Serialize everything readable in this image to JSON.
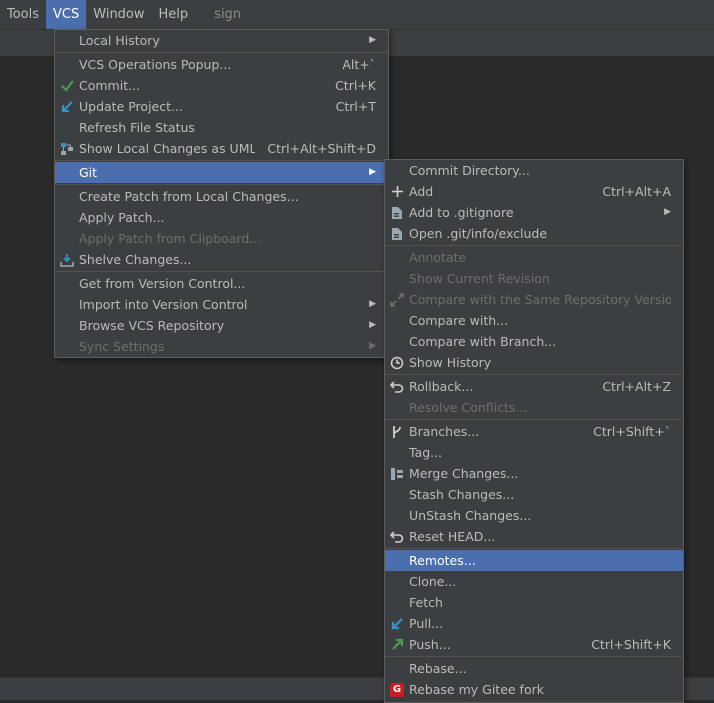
{
  "menubar": {
    "items": [
      "Tools",
      "VCS",
      "Window",
      "Help"
    ],
    "project_title": "sign"
  },
  "vcs_menu": {
    "items": [
      {
        "label": "Local History",
        "submenu": true
      },
      {
        "label": "VCS Operations Popup...",
        "shortcut": "Alt+`"
      },
      {
        "label": "Commit...",
        "shortcut": "Ctrl+K",
        "icon": "check-icon"
      },
      {
        "label": "Update Project...",
        "shortcut": "Ctrl+T",
        "icon": "update-arrow-icon"
      },
      {
        "label": "Refresh File Status"
      },
      {
        "label": "Show Local Changes as UML",
        "shortcut": "Ctrl+Alt+Shift+D",
        "icon": "uml-icon"
      },
      {
        "label": "Git",
        "submenu": true,
        "highlighted": true
      },
      {
        "label": "Create Patch from Local Changes..."
      },
      {
        "label": "Apply Patch..."
      },
      {
        "label": "Apply Patch from Clipboard...",
        "disabled": true
      },
      {
        "label": "Shelve Changes...",
        "icon": "shelve-icon"
      },
      {
        "label": "Get from Version Control..."
      },
      {
        "label": "Import into Version Control",
        "submenu": true
      },
      {
        "label": "Browse VCS Repository",
        "submenu": true
      },
      {
        "label": "Sync Settings",
        "submenu": true,
        "disabled": true
      }
    ]
  },
  "git_menu": {
    "items": [
      {
        "label": "Commit Directory..."
      },
      {
        "label": "Add",
        "shortcut": "Ctrl+Alt+A",
        "icon": "plus-icon"
      },
      {
        "label": "Add to .gitignore",
        "submenu": true,
        "icon": "gitignore-file-icon"
      },
      {
        "label": "Open .git/info/exclude",
        "icon": "exclude-file-icon"
      },
      {
        "label": "Annotate",
        "disabled": true
      },
      {
        "label": "Show Current Revision",
        "disabled": true
      },
      {
        "label": "Compare with the Same Repository Version",
        "disabled": true,
        "icon": "compare-icon"
      },
      {
        "label": "Compare with..."
      },
      {
        "label": "Compare with Branch..."
      },
      {
        "label": "Show History",
        "icon": "clock-icon"
      },
      {
        "label": "Rollback...",
        "shortcut": "Ctrl+Alt+Z",
        "icon": "rollback-icon"
      },
      {
        "label": "Resolve Conflicts...",
        "disabled": true
      },
      {
        "label": "Branches...",
        "shortcut": "Ctrl+Shift+`",
        "icon": "branch-icon"
      },
      {
        "label": "Tag..."
      },
      {
        "label": "Merge Changes...",
        "icon": "merge-icon"
      },
      {
        "label": "Stash Changes..."
      },
      {
        "label": "UnStash Changes..."
      },
      {
        "label": "Reset HEAD...",
        "icon": "reset-icon"
      },
      {
        "label": "Remotes...",
        "highlighted": true
      },
      {
        "label": "Clone..."
      },
      {
        "label": "Fetch"
      },
      {
        "label": "Pull...",
        "icon": "pull-arrow-icon"
      },
      {
        "label": "Push...",
        "shortcut": "Ctrl+Shift+K",
        "icon": "push-arrow-icon"
      },
      {
        "label": "Rebase..."
      },
      {
        "label": "Rebase my Gitee fork",
        "icon": "gitee-icon"
      }
    ]
  },
  "icon_glyphs": {
    "gitee": "G",
    "submenu_arrow": "▶"
  },
  "colors": {
    "menu_bg": "#3c3f41",
    "highlight": "#4b6eaf",
    "text": "#bbbbbb",
    "disabled_text": "#6e6e6e",
    "commit_green": "#499c54",
    "update_blue": "#3592c4",
    "gitee_red": "#c71d23"
  }
}
